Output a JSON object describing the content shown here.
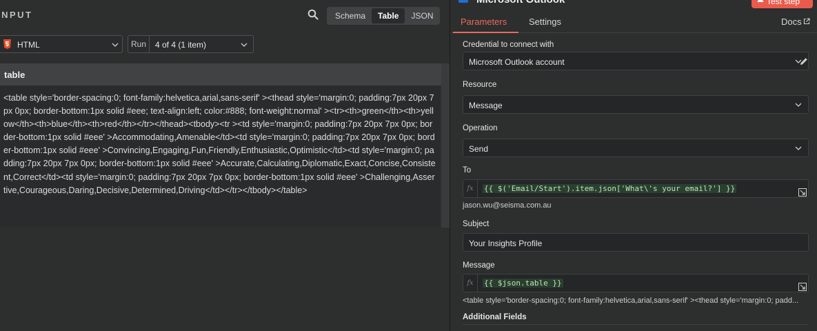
{
  "input_panel": {
    "title": "INPUT",
    "view_modes": [
      "Schema",
      "Table",
      "JSON"
    ],
    "active_view": "Table",
    "format_select": "HTML",
    "run_label": "Run",
    "run_select": "4 of 4 (1 item)",
    "column_header": "table",
    "cell_value": "<table style='border-spacing:0; font-family:helvetica,arial,sans-serif' ><thead style='margin:0; padding:7px 20px 7px 0px; border-bottom:1px solid #eee; text-align:left; color:#888; font-weight:normal' ><tr><th>green</th><th>yellow</th><th>blue</th><th>red</th></tr></thead><tbody><tr  ><td style='margin:0; padding:7px 20px 7px 0px; border-bottom:1px solid #eee' >Accommodating,Amenable</td><td style='margin:0; padding:7px 20px 7px 0px; border-bottom:1px solid #eee' >Convincing,Engaging,Fun,Friendly,Enthusiastic,Optimistic</td><td style='margin:0; padding:7px 20px 7px 0px; border-bottom:1px solid #eee' >Accurate,Calculating,Diplomatic,Exact,Concise,Consistent,Correct</td><td style='margin:0; padding:7px 20px 7px 0px; border-bottom:1px solid #eee' >Challenging,Assertive,Courageous,Daring,Decisive,Determined,Driving</td></tr></tbody></table>"
  },
  "node_panel": {
    "title": "Microsoft Outlook",
    "test_button": "Test step",
    "tabs": [
      "Parameters",
      "Settings"
    ],
    "active_tab": "Parameters",
    "docs_link": "Docs",
    "credential": {
      "label": "Credential to connect with",
      "value": "Microsoft Outlook account"
    },
    "resource": {
      "label": "Resource",
      "value": "Message"
    },
    "operation": {
      "label": "Operation",
      "value": "Send"
    },
    "to": {
      "label": "To",
      "expression": "{{ $('Email/Start').item.json['What\\'s your email?'] }}",
      "resolved": "jason.wu@seisma.com.au"
    },
    "subject": {
      "label": "Subject",
      "value": "Your Insights Profile"
    },
    "message": {
      "label": "Message",
      "expression": "{{ $json.table }}",
      "resolved": "<table style='border-spacing:0; font-family:helvetica,arial,sans-serif' ><thead style='margin:0; padd..."
    },
    "additional_fields_label": "Additional Fields"
  },
  "colors": {
    "accent": "#ea6b5c",
    "test_button": "#ea5b4c",
    "background": "#2d2e2e",
    "expression_text": "#b9e6b0"
  }
}
